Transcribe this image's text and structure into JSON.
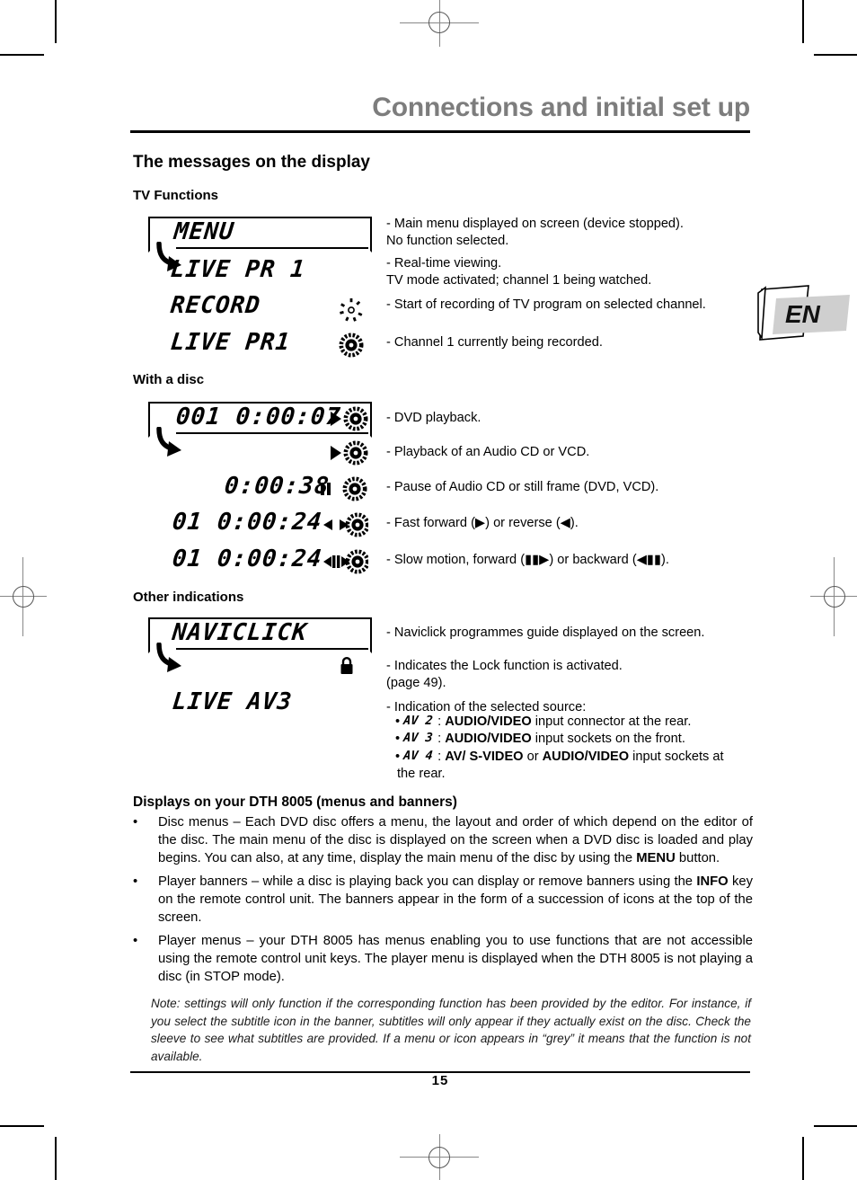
{
  "header": {
    "title": "Connections and initial set up",
    "language_badge": "EN"
  },
  "section_title": "The messages on the display",
  "tv_functions": {
    "heading": "TV Functions",
    "rows": [
      {
        "lcd": "MENU",
        "icon": "",
        "desc": "- Main menu displayed on screen (device stopped).\nNo function selected."
      },
      {
        "lcd": "LIVE PR 1",
        "icon": "",
        "desc": "- Real-time viewing.\nTV mode activated; channel 1 being watched."
      },
      {
        "lcd": "RECORD",
        "icon": "disc-blinking",
        "desc": "- Start of recording of TV program on selected channel."
      },
      {
        "lcd": "LIVE PR1",
        "icon": "disc-spinning",
        "desc": "- Channel 1 currently being recorded."
      }
    ]
  },
  "with_a_disc": {
    "heading": "With a disc",
    "rows": [
      {
        "lcd": "001 0:00:07",
        "icon": "play-disc",
        "desc": "- DVD playback."
      },
      {
        "lcd": "",
        "icon": "play-disc",
        "desc": "- Playback of an Audio CD or VCD."
      },
      {
        "lcd": "0:00:38",
        "icon": "pause-disc",
        "desc": "- Pause of Audio CD or still frame (DVD, VCD)."
      },
      {
        "lcd": "01   0:00:24",
        "icon": "rew-fwd-disc",
        "desc": "- Fast forward (▶) or reverse (◀)."
      },
      {
        "lcd": "01   0:00:24",
        "icon": "slow-motion-disc",
        "desc": "- Slow motion, forward (▮▮▶) or backward (◀▮▮)."
      }
    ]
  },
  "other_indications": {
    "heading": "Other indications",
    "rows": [
      {
        "lcd": "NAVICLICK",
        "icon": "",
        "desc": "- Naviclick programmes guide displayed on the screen."
      },
      {
        "lcd": "",
        "icon": "lock-icon",
        "desc": "- Indicates the Lock function is activated.\n(page 49)."
      },
      {
        "lcd": "LIVE AV3",
        "icon": "",
        "desc": "- Indication of the selected source:"
      }
    ],
    "source_list_intro": "- Indication of the selected source:",
    "source_items": [
      {
        "bullet": "•",
        "code": "AV 2",
        "text_parts": [
          {
            "t": "AUDIO/VIDEO",
            "bold": true
          },
          {
            "t": " input connector at the rear.",
            "bold": false
          }
        ]
      },
      {
        "bullet": "•",
        "code": "AV 3",
        "text_parts": [
          {
            "t": "AUDIO/VIDEO",
            "bold": true
          },
          {
            "t": " input sockets on the front.",
            "bold": false
          }
        ]
      },
      {
        "bullet": "•",
        "code": "AV 4",
        "text_parts": [
          {
            "t": "AV/ S-VIDEO",
            "bold": true
          },
          {
            "t": " or ",
            "bold": false
          },
          {
            "t": "AUDIO/VIDEO",
            "bold": true
          },
          {
            "t": " input sockets at the rear.",
            "bold": false
          }
        ]
      }
    ]
  },
  "displays_section": {
    "heading": "Displays on your DTH 8005 (menus and banners)",
    "bullets": [
      {
        "mark": "•",
        "html_key": "b1"
      },
      {
        "mark": "•",
        "html_key": "b2"
      },
      {
        "mark": "•",
        "html_key": "b3"
      }
    ],
    "b1_pre": "Disc menus – Each DVD disc offers a menu, the layout and order of which depend on the editor of the disc. The main menu of the disc is displayed on the screen when a DVD disc is loaded and play begins. You can also, at any time, display the main menu of the disc by using the ",
    "b1_bold": "MENU",
    "b1_post": " button.",
    "b2_pre": "Player banners – while a disc is playing back you can display or remove banners using the ",
    "b2_bold": "INFO",
    "b2_post": " key on the remote control unit. The banners appear in the form of a succession of icons at the top of the screen.",
    "b3_pre": "Player menus – your DTH 8005 has menus enabling you to use functions that are not accessible using the remote control unit keys. The player menu is displayed when the DTH 8005 is not playing a disc (in STOP mode).",
    "b3_bold": "",
    "b3_post": ""
  },
  "note": "Note: settings will only function if the corresponding function has been provided by the editor. For instance, if you select the subtitle icon in the banner, subtitles will only appear if they actually exist on the disc. Check the sleeve to see what subtitles are provided. If a menu or icon appears in “grey” it means that the function is not available.",
  "footer": {
    "page_number": "15"
  },
  "colors": {
    "title_grey": "#7d7d7d",
    "badge_grey": "#cfcfcf",
    "ink": "#000000"
  }
}
